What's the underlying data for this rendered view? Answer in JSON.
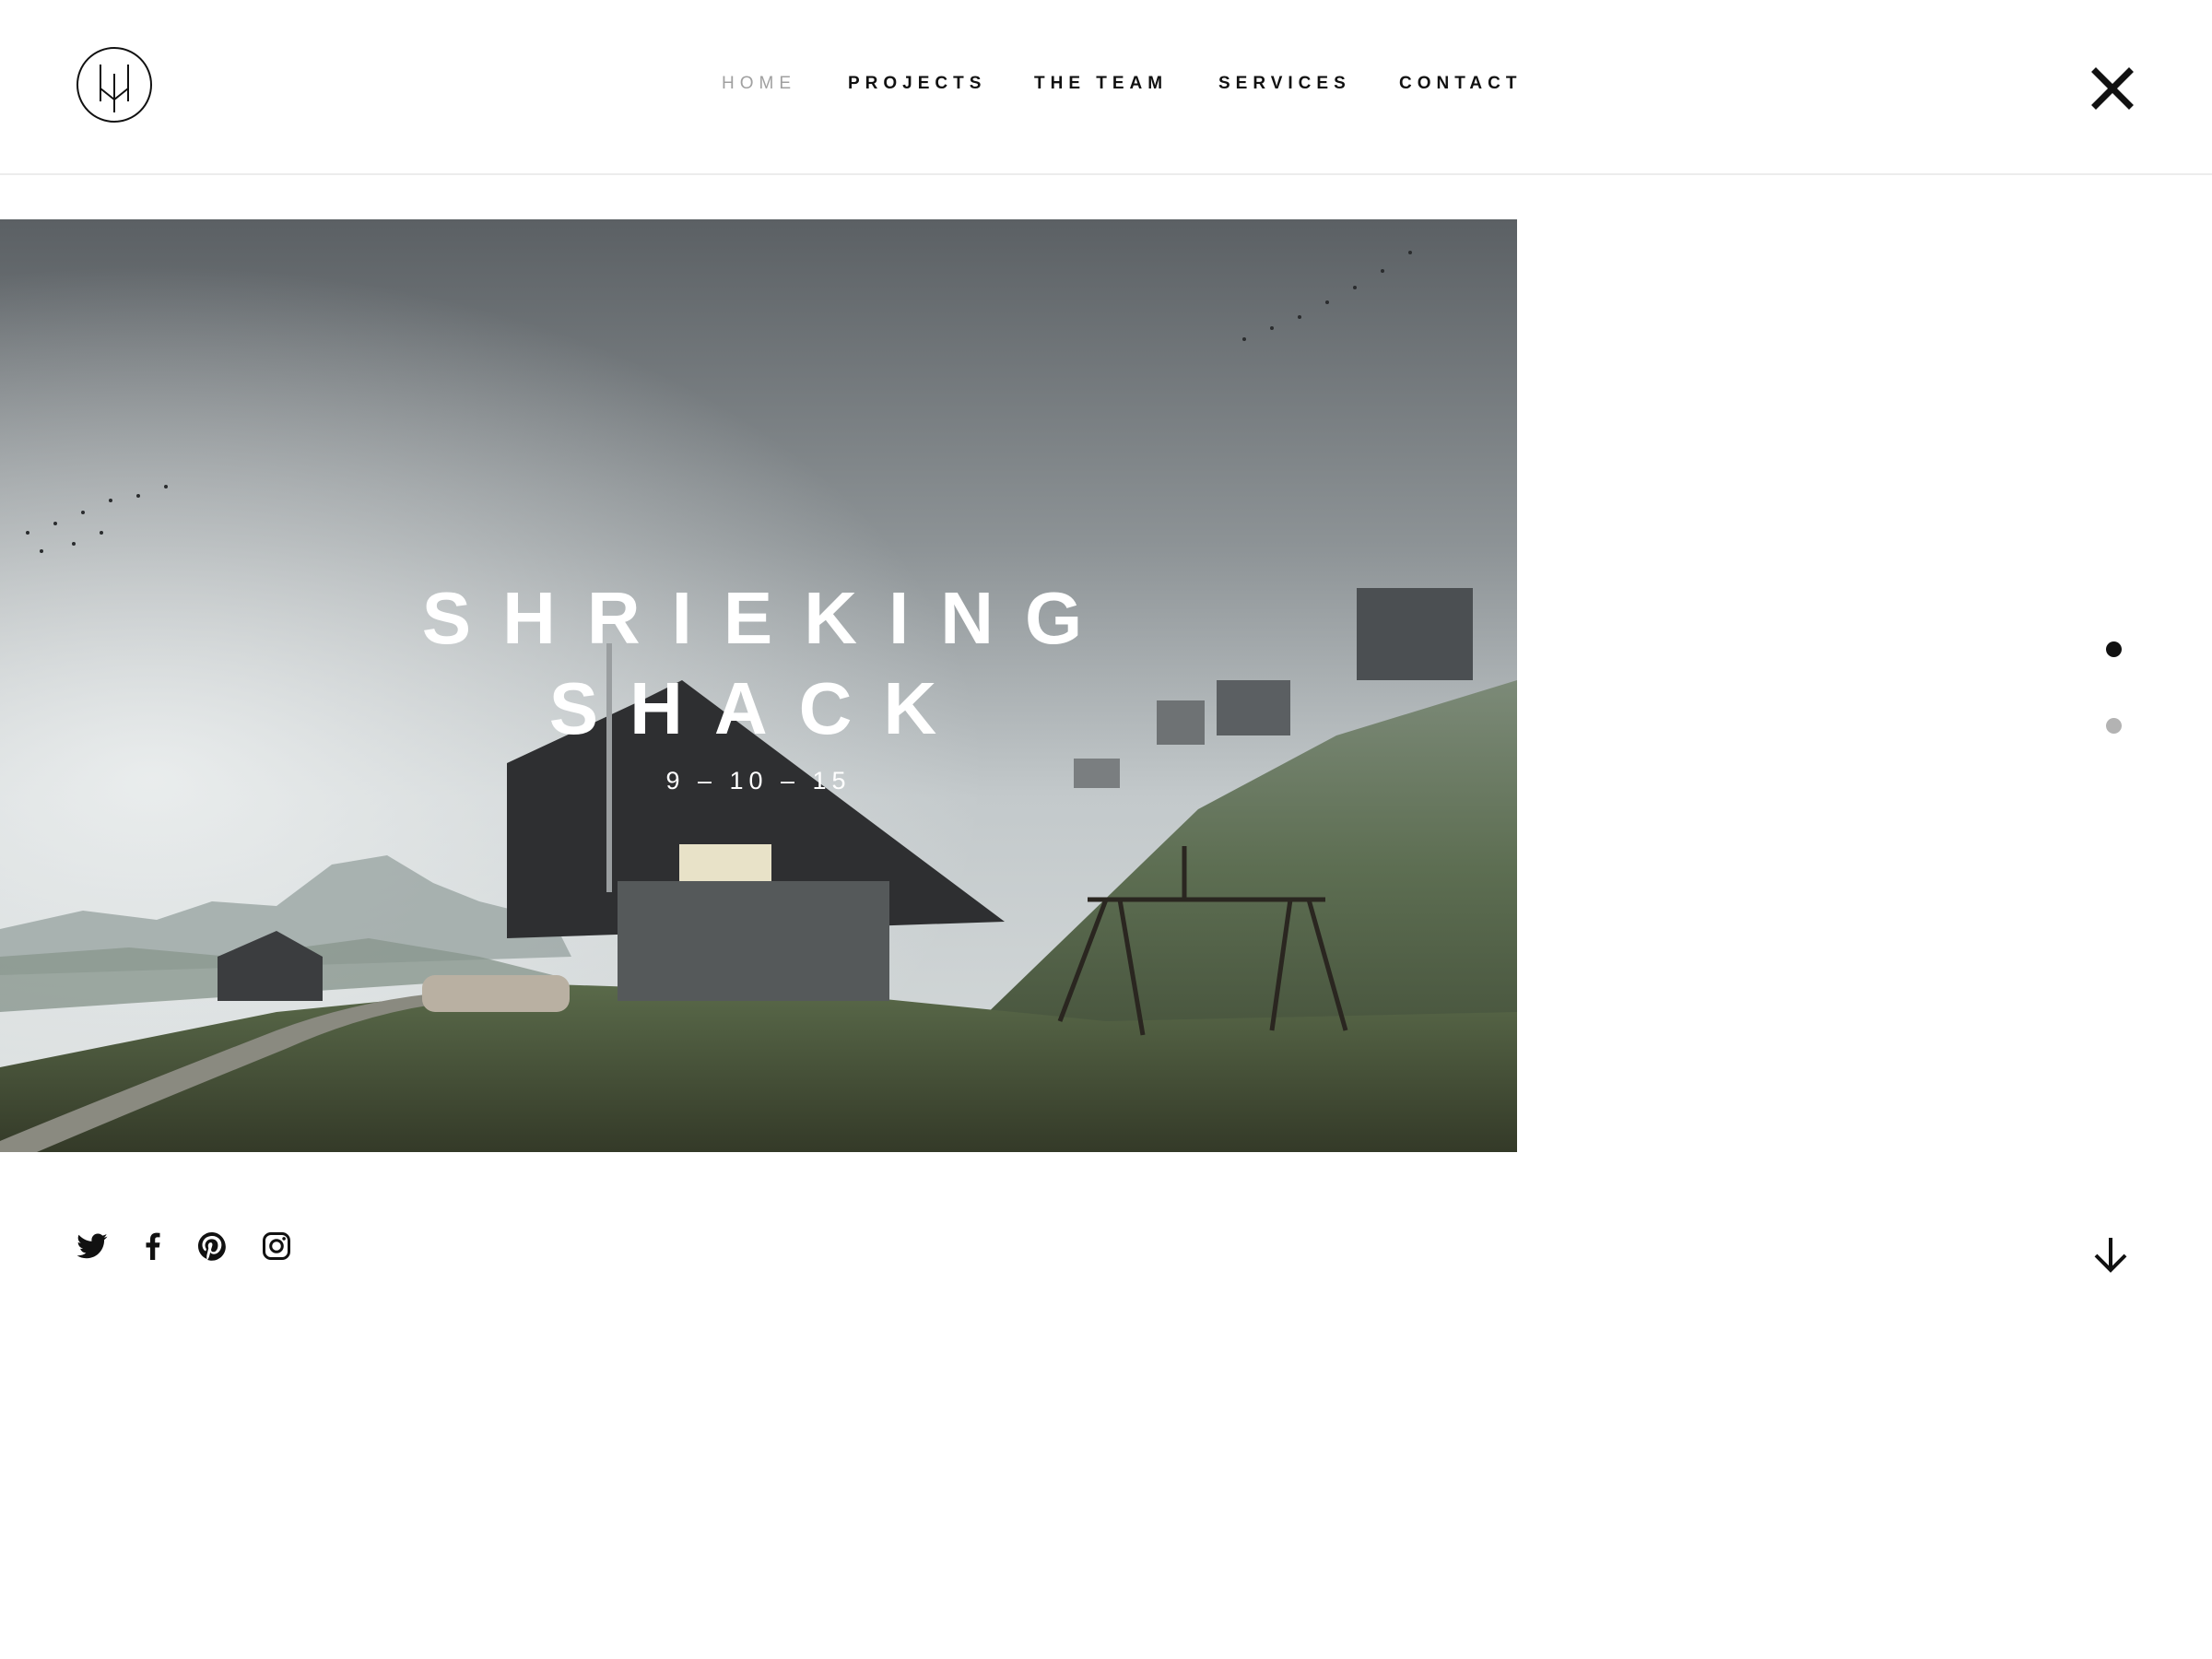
{
  "header": {
    "logo_icon": "monogram-logo",
    "nav": [
      {
        "label": "HOME",
        "active": true
      },
      {
        "label": "PROJECTS",
        "active": false
      },
      {
        "label": "THE TEAM",
        "active": false
      },
      {
        "label": "SERVICES",
        "active": false
      },
      {
        "label": "CONTACT",
        "active": false
      }
    ],
    "close_icon": "close-icon"
  },
  "hero": {
    "title_line1": "SHRIEKING",
    "title_line2": "SHACK",
    "date": "9 – 10 – 15",
    "image_description_icon": "landscape-photo"
  },
  "pager": {
    "slides": 2,
    "active_slide": 1,
    "active_color": "#111111",
    "inactive_color": "#b3b3b3"
  },
  "social": [
    "twitter-icon",
    "facebook-icon",
    "pinterest-icon",
    "instagram-icon"
  ],
  "footer": {
    "scroll_icon": "arrow-down-icon"
  },
  "colors": {
    "nav_active": "#a0a0a0",
    "text": "#111111",
    "background": "#ffffff"
  }
}
